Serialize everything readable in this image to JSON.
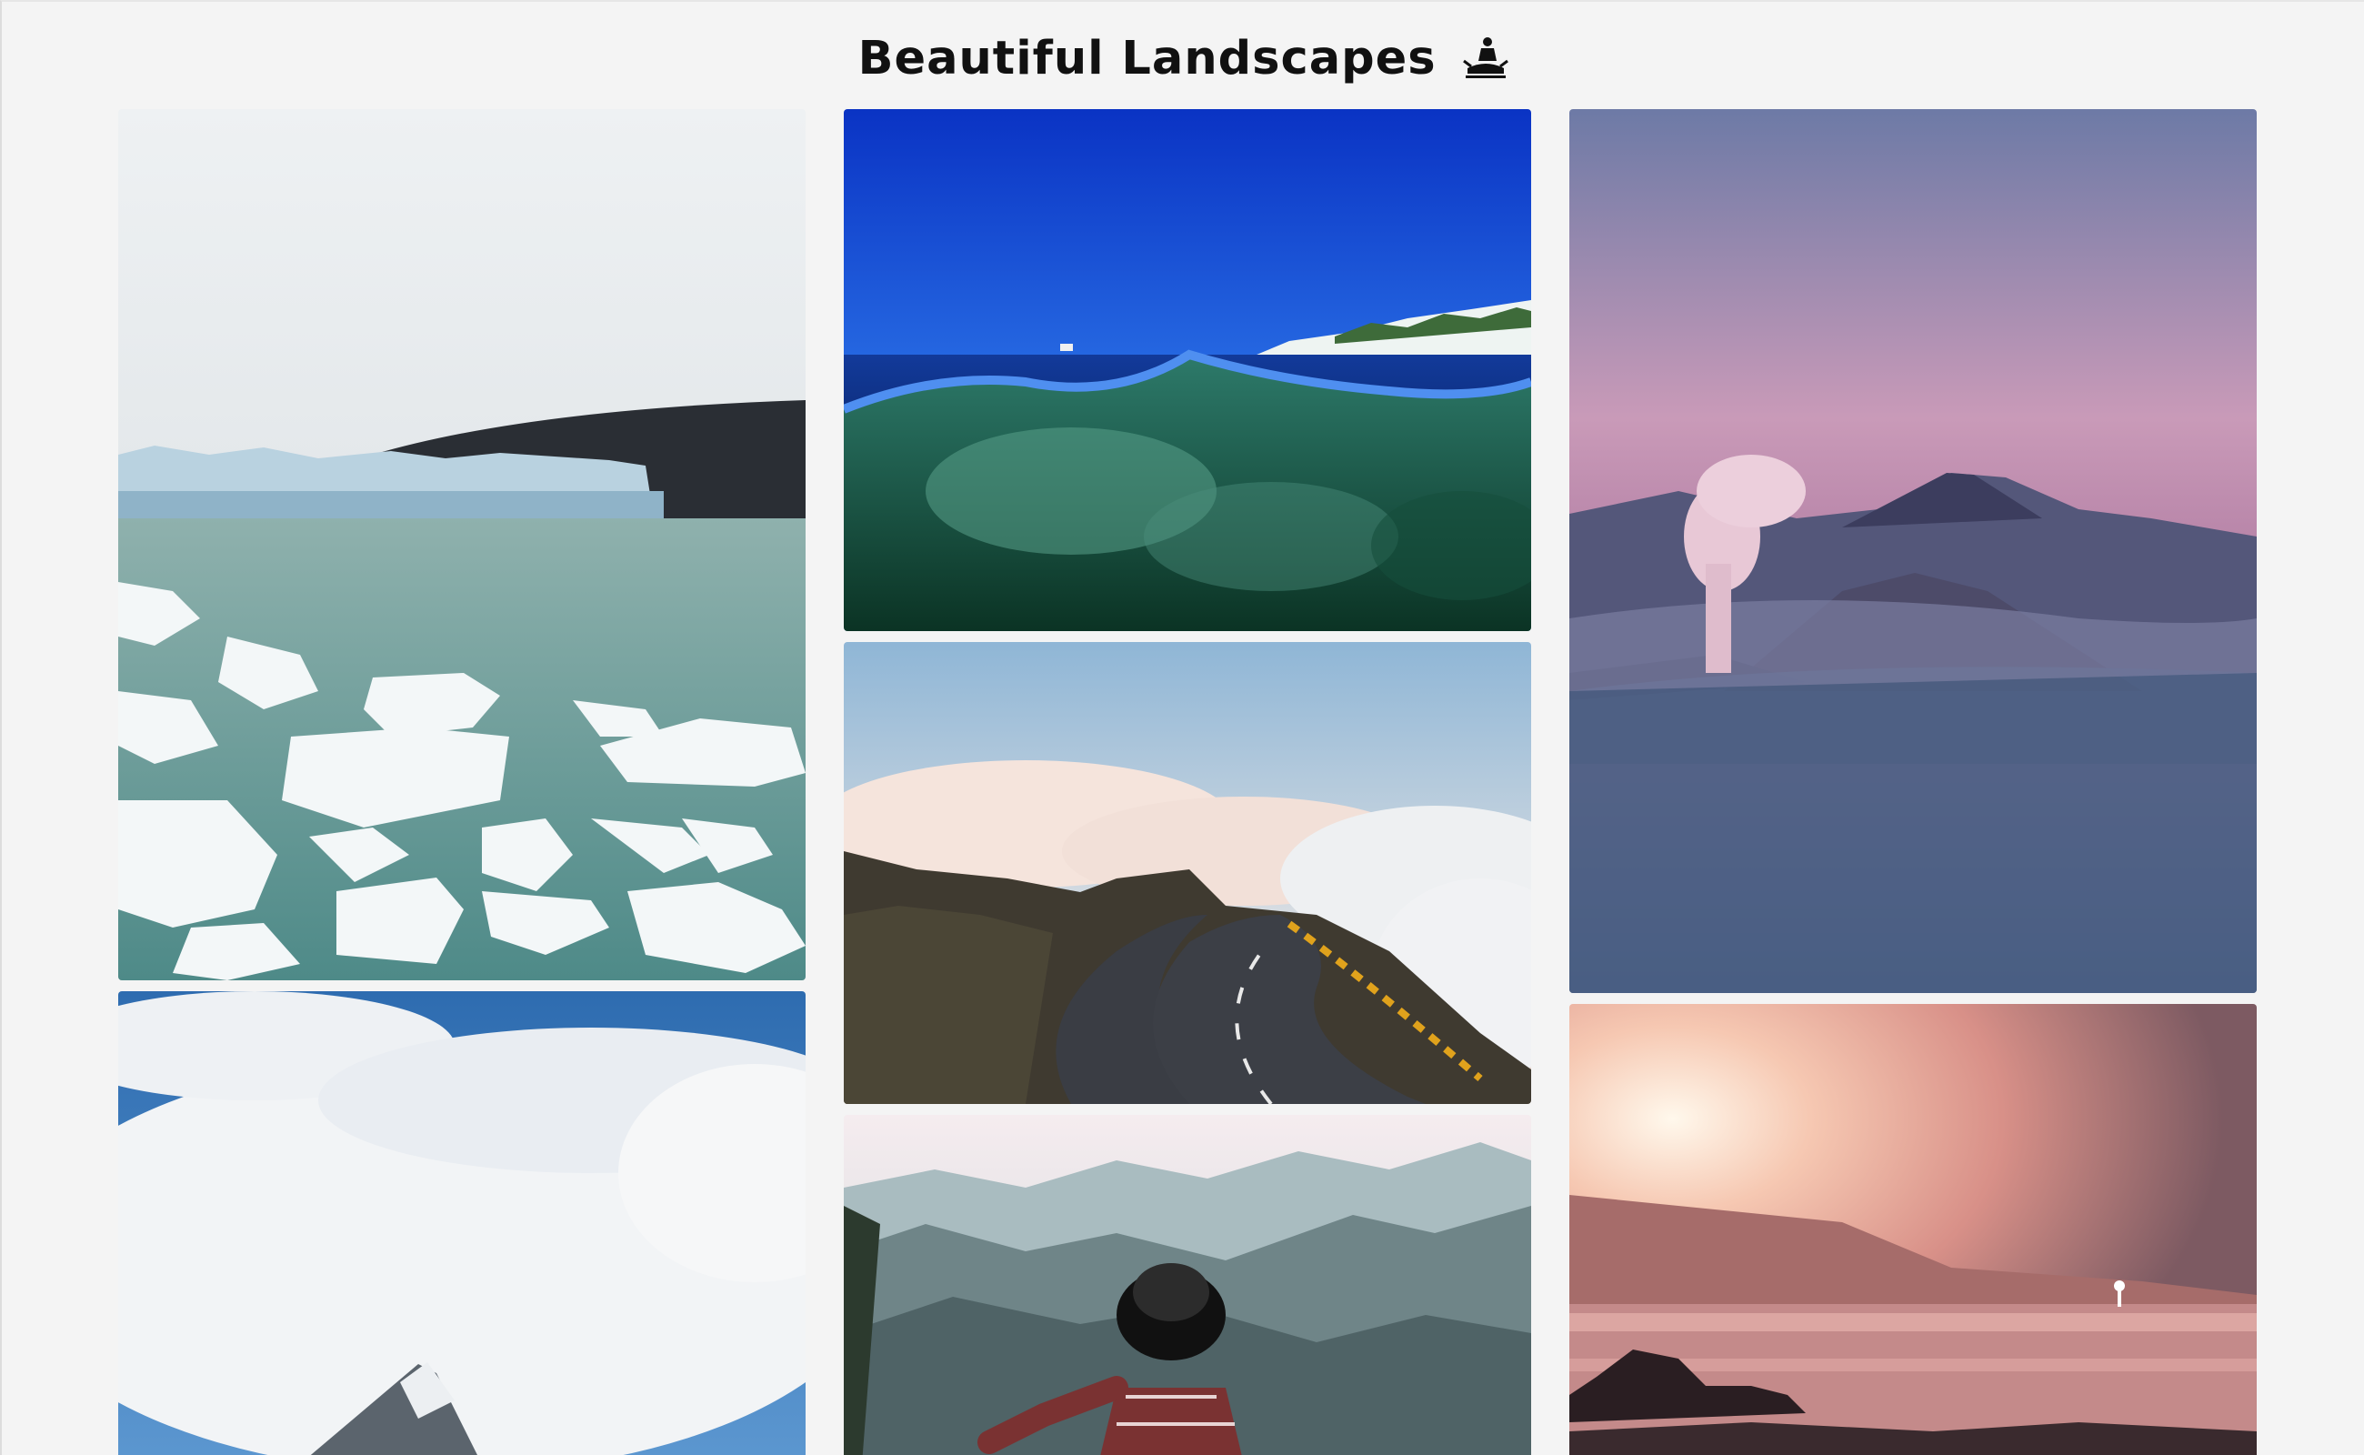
{
  "page": {
    "title": "Beautiful Landscapes",
    "title_emoji_icon": "person-in-lotus-position-icon"
  },
  "gallery": {
    "columns": [
      {
        "images": [
          {
            "subject": "glacier-lagoon-photo"
          },
          {
            "subject": "snowy-mountain-peak-photo"
          }
        ]
      },
      {
        "images": [
          {
            "subject": "ocean-split-view-photo"
          },
          {
            "subject": "winding-mountain-road-photo"
          },
          {
            "subject": "hiker-with-hat-mountains-photo"
          }
        ]
      },
      {
        "images": [
          {
            "subject": "volcano-at-dusk-photo"
          },
          {
            "subject": "sunset-coast-photo"
          }
        ]
      }
    ]
  },
  "colors": {
    "background": "#f4f4f4",
    "title_text": "#111111"
  }
}
